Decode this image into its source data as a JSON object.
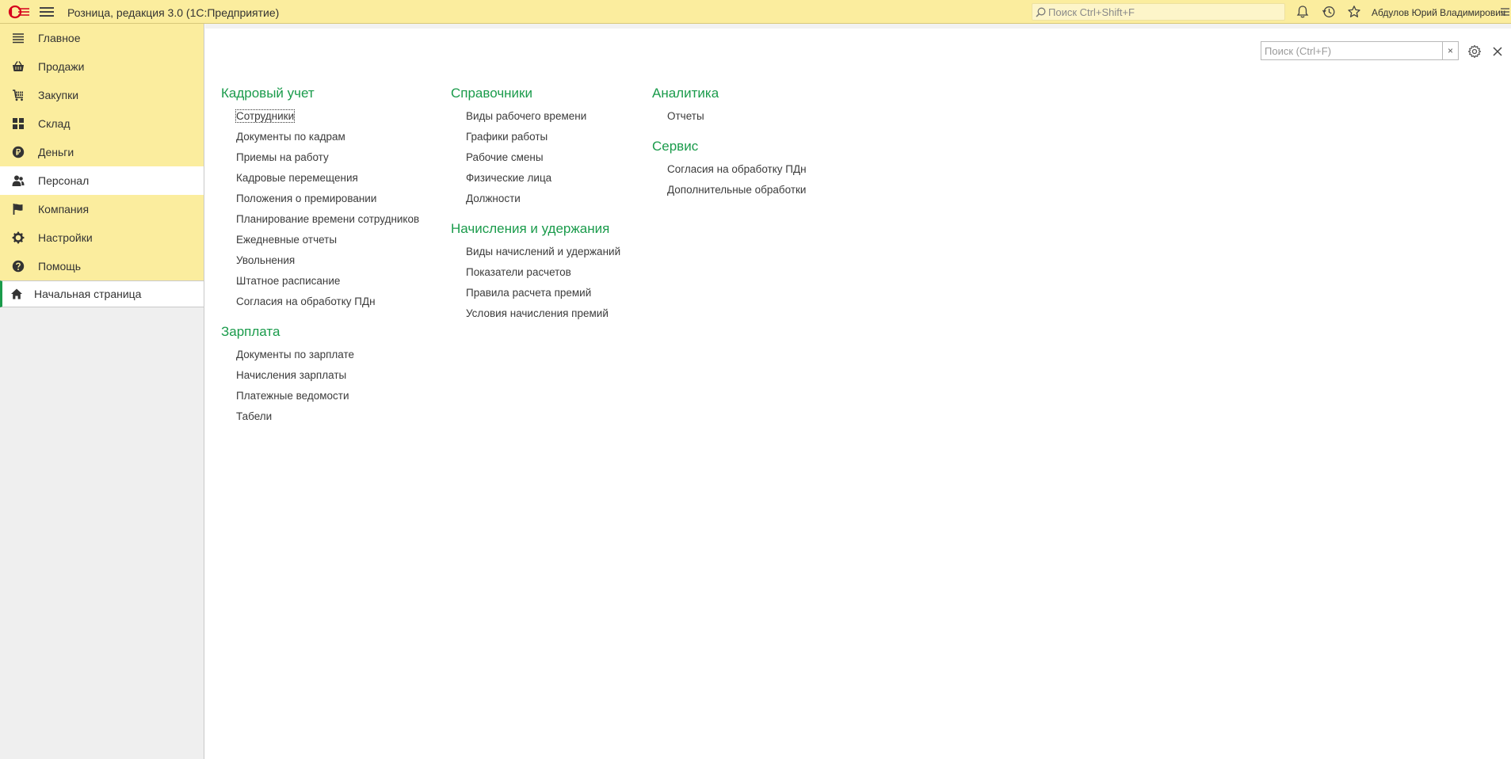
{
  "topbar": {
    "app_title": "Розница, редакция 3.0  (1С:Предприятие)",
    "search_placeholder": "Поиск Ctrl+Shift+F",
    "user_name": "Абдулов Юрий Владимирович"
  },
  "sidebar": {
    "sections": [
      {
        "label": "Главное",
        "icon": "menu-lines-icon"
      },
      {
        "label": "Продажи",
        "icon": "basket-icon"
      },
      {
        "label": "Закупки",
        "icon": "cart-icon"
      },
      {
        "label": "Склад",
        "icon": "grid-icon"
      },
      {
        "label": "Деньги",
        "icon": "ruble-coin-icon"
      },
      {
        "label": "Персонал",
        "icon": "people-icon",
        "active": true
      },
      {
        "label": "Компания",
        "icon": "flag-icon"
      },
      {
        "label": "Настройки",
        "icon": "gear-icon"
      },
      {
        "label": "Помощь",
        "icon": "question-icon"
      }
    ],
    "home_label": "Начальная страница"
  },
  "main": {
    "search_placeholder": "Поиск (Ctrl+F)",
    "clear_label": "×",
    "columns": [
      {
        "groups": [
          {
            "title": "Кадровый учет",
            "items": [
              "Сотрудники",
              "Документы по кадрам",
              "Приемы на работу",
              "Кадровые перемещения",
              "Положения о премировании",
              "Планирование времени сотрудников",
              "Ежедневные отчеты",
              "Увольнения",
              "Штатное расписание",
              "Согласия на обработку ПДн"
            ]
          },
          {
            "title": "Зарплата",
            "items": [
              "Документы по зарплате",
              "Начисления зарплаты",
              "Платежные ведомости",
              "Табели"
            ]
          }
        ]
      },
      {
        "groups": [
          {
            "title": "Справочники",
            "items": [
              "Виды рабочего времени",
              "Графики работы",
              "Рабочие смены",
              "Физические лица",
              "Должности"
            ]
          },
          {
            "title": "Начисления и удержания",
            "items": [
              "Виды начислений и удержаний",
              "Показатели расчетов",
              "Правила расчета премий",
              "Условия начисления премий"
            ]
          }
        ]
      },
      {
        "groups": [
          {
            "title": "Аналитика",
            "items": [
              "Отчеты"
            ]
          },
          {
            "title": "Сервис",
            "items": [
              "Согласия на обработку ПДн",
              "Дополнительные обработки"
            ]
          }
        ]
      }
    ]
  },
  "colors": {
    "accent_green": "#1a9b4b",
    "panel_yellow": "#fbed9e"
  }
}
